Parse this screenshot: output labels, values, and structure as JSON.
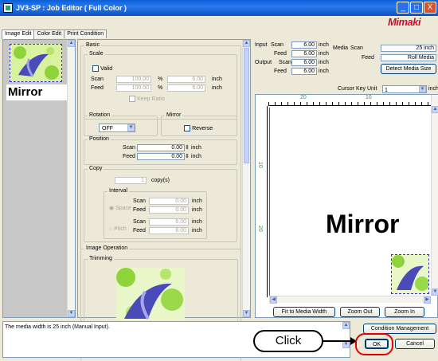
{
  "window": {
    "title": "JV3-SP : Job Editor ( Full Color )",
    "minimize": "_",
    "maximize": "□",
    "close": "X"
  },
  "logo": "Mimaki",
  "tabs": [
    "Image Edit",
    "Color Edit",
    "Print Condition"
  ],
  "thumb_label": "Mirror",
  "basic": {
    "title": "Basic",
    "scale": {
      "title": "Scale",
      "valid_label": "Valid",
      "scan_label": "Scan",
      "feed_label": "Feed",
      "scan_pct": "100.00",
      "feed_pct": "100.00",
      "pct_unit": "%",
      "scan_inch": "6.00",
      "feed_inch": "6.00",
      "inch_unit": "inch",
      "keep_ratio": "Keep Ratio"
    },
    "rotation": {
      "title": "Rotation",
      "value": "OFF"
    },
    "mirror": {
      "title": "Mirror",
      "reverse_label": "Reverse"
    },
    "position": {
      "title": "Position",
      "scan_label": "Scan",
      "feed_label": "Feed",
      "scan": "0.00",
      "feed": "0.00",
      "unit": "inch"
    },
    "copy": {
      "title": "Copy",
      "count": "1",
      "unit": "copy(s)",
      "interval_title": "Interval",
      "space_label": "Space",
      "pitch_label": "Pitch",
      "scan_label": "Scan",
      "feed_label": "Feed",
      "space_scan": "0.00",
      "space_feed": "0.00",
      "pitch_scan": "6.00",
      "pitch_feed": "6.00",
      "inch": "inch"
    }
  },
  "image_operation": {
    "title": "Image Operation",
    "trimming_title": "Trimming"
  },
  "info": {
    "input_label": "Input",
    "output_label": "Output",
    "scan_label": "Scan",
    "feed_label": "Feed",
    "input_scan": "6.00",
    "input_feed": "6.00",
    "output_scan": "6.00",
    "output_feed": "6.00",
    "unit": "inch",
    "media_label": "Media",
    "media_scan": "25 inch",
    "media_feed": "Roll Media",
    "detect_button": "Detect Media Size",
    "cursor_key_label": "Cursor Key Unit",
    "cursor_key_value": "1",
    "cursor_unit": "inch"
  },
  "ruler": {
    "marks": [
      "20",
      "10"
    ],
    "v_marks": [
      "10",
      "20"
    ]
  },
  "preview_text": "Mirror",
  "zoom": {
    "fit": "Fit to Media Width",
    "out": "Zoom Out",
    "in": "Zoom In"
  },
  "status_message": "The media width is 25 inch (Manual Input).",
  "condition_button": "Condition Management",
  "ok_button": "OK",
  "cancel_button": "Cancel",
  "callout": "Click",
  "colors": {
    "titlebar": "#0a5fd8",
    "logo": "#c8102e",
    "callout": "#e00000"
  }
}
